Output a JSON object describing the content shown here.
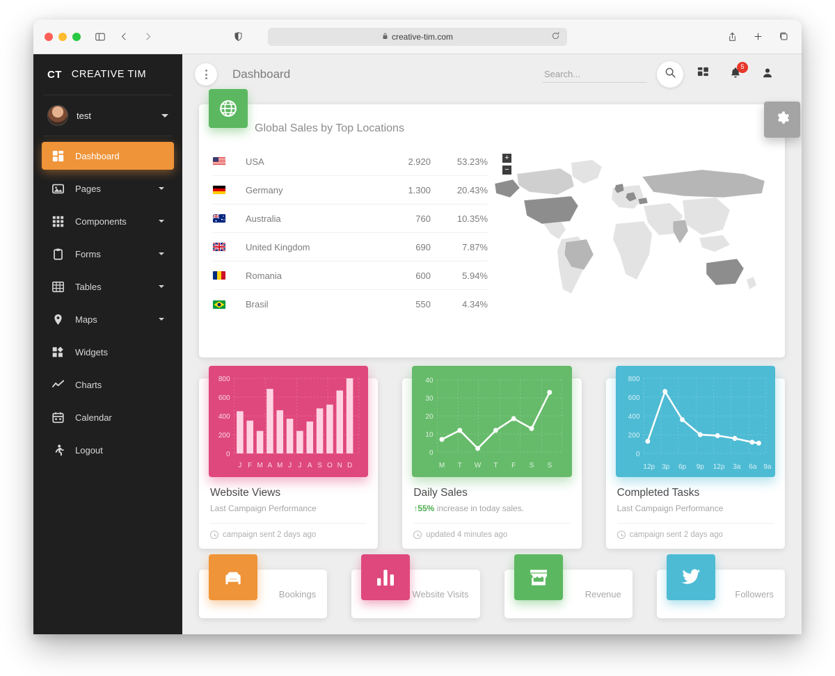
{
  "browser": {
    "url": "creative-tim.com",
    "lock_icon": "lock-icon",
    "reload_icon": "reload-icon",
    "sidebar_toggle_icon": "sidebar-toggle-icon",
    "back_icon": "back-arrow-icon",
    "forward_icon": "forward-arrow-icon",
    "shield_icon": "privacy-shield-icon",
    "share_icon": "share-icon",
    "newtab_icon": "plus-icon",
    "tabs_icon": "tab-overview-icon"
  },
  "sidebar": {
    "brand_mark": "CT",
    "brand_name": "CREATIVE TIM",
    "user": {
      "name": "test",
      "avatar": "user-avatar",
      "caret": "chevron-down-icon"
    },
    "items": [
      {
        "label": "Dashboard",
        "icon": "dashboard-icon",
        "active": true,
        "caret": false
      },
      {
        "label": "Pages",
        "icon": "image-icon",
        "active": false,
        "caret": true
      },
      {
        "label": "Components",
        "icon": "grid-dots-icon",
        "active": false,
        "caret": true
      },
      {
        "label": "Forms",
        "icon": "clipboard-icon",
        "active": false,
        "caret": true
      },
      {
        "label": "Tables",
        "icon": "table-icon",
        "active": false,
        "caret": true
      },
      {
        "label": "Maps",
        "icon": "map-pin-icon",
        "active": false,
        "caret": true
      },
      {
        "label": "Widgets",
        "icon": "widgets-icon",
        "active": false,
        "caret": false
      },
      {
        "label": "Charts",
        "icon": "line-chart-icon",
        "active": false,
        "caret": false
      },
      {
        "label": "Calendar",
        "icon": "calendar-icon",
        "active": false,
        "caret": false
      },
      {
        "label": "Logout",
        "icon": "logout-run-icon",
        "active": false,
        "caret": false
      }
    ]
  },
  "topbar": {
    "menu_icon": "kebab-menu-icon",
    "title": "Dashboard",
    "search_placeholder": "Search...",
    "search_value": "",
    "search_icon": "search-icon",
    "apps_icon": "apps-grid-icon",
    "bell_icon": "bell-icon",
    "notification_count": "5",
    "person_icon": "person-icon"
  },
  "map_card": {
    "badge_icon": "globe-icon",
    "badge_color": "#5cb860",
    "title": "Global Sales by Top Locations",
    "settings_icon": "gear-icon",
    "zoom_in": "+",
    "zoom_out": "−",
    "rows": [
      {
        "flag": "flag-usa",
        "country": "USA",
        "value": "2.920",
        "pct": "53.23%"
      },
      {
        "flag": "flag-germany",
        "country": "Germany",
        "value": "1.300",
        "pct": "20.43%"
      },
      {
        "flag": "flag-australia",
        "country": "Australia",
        "value": "760",
        "pct": "10.35%"
      },
      {
        "flag": "flag-uk",
        "country": "United Kingdom",
        "value": "690",
        "pct": "7.87%"
      },
      {
        "flag": "flag-romania",
        "country": "Romania",
        "value": "600",
        "pct": "5.94%"
      },
      {
        "flag": "flag-brasil",
        "country": "Brasil",
        "value": "550",
        "pct": "4.34%"
      }
    ]
  },
  "chart_cards": [
    {
      "color": "#df487c",
      "title": "Website Views",
      "subtitle": "Last Campaign Performance",
      "footer": "campaign sent 2 days ago",
      "footer_icon": "clock-icon"
    },
    {
      "color": "#66bb6a",
      "title": "Daily Sales",
      "subtitle_prefix": "55%",
      "subtitle": " increase in today sales.",
      "subtitle_arrow": "arrow-up-icon",
      "footer": "updated 4 minutes ago",
      "footer_icon": "clock-icon"
    },
    {
      "color": "#4dbbd4",
      "title": "Completed Tasks",
      "subtitle": "Last Campaign Performance",
      "footer": "campaign sent 2 days ago",
      "footer_icon": "clock-icon"
    }
  ],
  "stat_cards": [
    {
      "label": "Bookings",
      "icon": "sofa-icon",
      "color": "#ef9439"
    },
    {
      "label": "Website Visits",
      "icon": "bar-chart-icon",
      "color": "#df487c"
    },
    {
      "label": "Revenue",
      "icon": "store-icon",
      "color": "#5cb860"
    },
    {
      "label": "Followers",
      "icon": "twitter-icon",
      "color": "#4dbbd4"
    }
  ],
  "chart_data": [
    {
      "type": "bar",
      "title": "Website Views",
      "categories": [
        "J",
        "F",
        "M",
        "A",
        "M",
        "J",
        "J",
        "A",
        "S",
        "O",
        "N",
        "D"
      ],
      "values": [
        450,
        350,
        240,
        690,
        460,
        370,
        240,
        340,
        480,
        520,
        670,
        800
      ],
      "ytick_labels": [
        "800",
        "600",
        "400",
        "200",
        "0"
      ],
      "yticks": [
        800,
        600,
        400,
        200,
        0
      ],
      "ylim": [
        0,
        900
      ],
      "xlabel": "",
      "ylabel": "",
      "grid": true,
      "legend": "none",
      "series_color": "#ffd3e2",
      "background": "#df487c"
    },
    {
      "type": "line",
      "title": "Daily Sales",
      "categories": [
        "M",
        "T",
        "W",
        "T",
        "F",
        "S",
        "S"
      ],
      "values": [
        7,
        12,
        2,
        12,
        18.5,
        13,
        33
      ],
      "ytick_labels": [
        "40",
        "30",
        "20",
        "10",
        "0"
      ],
      "yticks": [
        40,
        30,
        20,
        10,
        0
      ],
      "ylim": [
        0,
        45
      ],
      "xlabel": "",
      "ylabel": "",
      "grid": true,
      "legend": "none",
      "series_color": "#ffffff",
      "background": "#66bb6a"
    },
    {
      "type": "line",
      "title": "Completed Tasks",
      "categories": [
        "12p",
        "3p",
        "6p",
        "9p",
        "12p",
        "3a",
        "6a",
        "9a"
      ],
      "values": [
        130,
        660,
        360,
        200,
        190,
        160,
        120,
        110
      ],
      "ytick_labels": [
        "800",
        "600",
        "400",
        "200",
        "0"
      ],
      "yticks": [
        800,
        600,
        400,
        200,
        0
      ],
      "ylim": [
        0,
        900
      ],
      "xlabel": "",
      "ylabel": "",
      "grid": true,
      "legend": "none",
      "series_color": "#ffffff",
      "background": "#4dbbd4"
    }
  ]
}
